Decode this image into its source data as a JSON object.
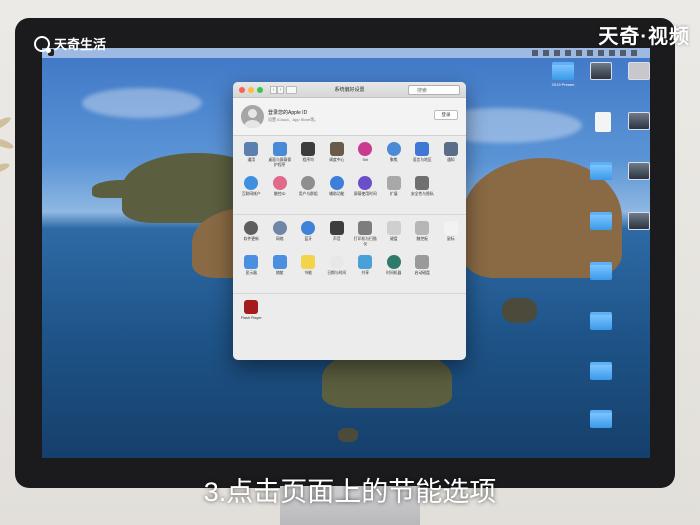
{
  "watermark": {
    "left": "天奇生活",
    "right": "天奇·视频"
  },
  "caption": "3.点击页面上的节能选项",
  "colors": {
    "accent": "#3a9ae8",
    "close": "#fc605b",
    "minimize": "#fdbc40",
    "zoom": "#34c84a"
  },
  "window": {
    "title": "系统偏好设置",
    "search_placeholder": "搜索",
    "account_title": "登录您的Apple ID",
    "account_subtitle": "设置 iCloud、App Store等。",
    "login_button": "登录"
  },
  "desktop_icons": [
    {
      "label": "2019 Presen"
    },
    {
      "label": ""
    },
    {
      "label": ""
    },
    {
      "label": ""
    },
    {
      "label": ""
    },
    {
      "label": ""
    },
    {
      "label": ""
    },
    {
      "label": ""
    },
    {
      "label": ""
    },
    {
      "label": ""
    },
    {
      "label": ""
    },
    {
      "label": ""
    },
    {
      "label": ""
    },
    {
      "label": ""
    },
    {
      "label": ""
    },
    {
      "label": ""
    }
  ],
  "panes_row1": [
    {
      "label": "通用",
      "icon": "general-icon",
      "color": "#5b7fae"
    },
    {
      "label": "桌面与屏幕保护程序",
      "icon": "desktop-icon",
      "color": "#4a88d8"
    },
    {
      "label": "程序坞",
      "icon": "dock-icon",
      "color": "#3c3c3c"
    },
    {
      "label": "调度中心",
      "icon": "mission-control-icon",
      "color": "#6a5a4a"
    },
    {
      "label": "Siri",
      "icon": "siri-icon",
      "color": "#c93b8e"
    },
    {
      "label": "聚焦",
      "icon": "spotlight-icon",
      "color": "#4b8ad6"
    },
    {
      "label": "语言与地区",
      "icon": "language-icon",
      "color": "#3f78d4"
    },
    {
      "label": "通知",
      "icon": "notifications-icon",
      "color": "#5a6c86"
    }
  ],
  "panes_row2": [
    {
      "label": "互联网帐户",
      "icon": "internet-accounts-icon",
      "color": "#3f8fe0"
    },
    {
      "label": "触控ID",
      "icon": "touch-id-icon",
      "color": "#e06a8a"
    },
    {
      "label": "用户与群组",
      "icon": "users-icon",
      "color": "#8e8e8e"
    },
    {
      "label": "辅助功能",
      "icon": "accessibility-icon",
      "color": "#3d7fd8"
    },
    {
      "label": "屏幕使用时间",
      "icon": "screen-time-icon",
      "color": "#6b4fc8"
    },
    {
      "label": "扩展",
      "icon": "extensions-icon",
      "color": "#a8a8a8"
    },
    {
      "label": "安全性与隐私",
      "icon": "security-icon",
      "color": "#6f6f6f"
    }
  ],
  "panes_row3": [
    {
      "label": "软件更新",
      "icon": "software-update-icon",
      "color": "#5e5e5e"
    },
    {
      "label": "网络",
      "icon": "network-icon",
      "color": "#6f86a8"
    },
    {
      "label": "蓝牙",
      "icon": "bluetooth-icon",
      "color": "#3f82d8"
    },
    {
      "label": "声音",
      "icon": "sound-icon",
      "color": "#3d3d3d"
    },
    {
      "label": "打印机与扫描仪",
      "icon": "printer-icon",
      "color": "#7d7d7d"
    },
    {
      "label": "键盘",
      "icon": "keyboard-icon",
      "color": "#cfcfcf"
    },
    {
      "label": "触控板",
      "icon": "trackpad-icon",
      "color": "#b6b6b6"
    },
    {
      "label": "鼠标",
      "icon": "mouse-icon",
      "color": "#f2f2f2"
    }
  ],
  "panes_row4": [
    {
      "label": "显示器",
      "icon": "displays-icon",
      "color": "#4a8fe0"
    },
    {
      "label": "随航",
      "icon": "sidecar-icon",
      "color": "#4a8fe0"
    },
    {
      "label": "节能",
      "icon": "energy-saver-icon",
      "color": "#f3d34a"
    },
    {
      "label": "日期与时间",
      "icon": "date-time-icon",
      "color": "#e8e8e8"
    },
    {
      "label": "共享",
      "icon": "sharing-icon",
      "color": "#4aa0d8"
    },
    {
      "label": "时间机器",
      "icon": "time-machine-icon",
      "color": "#2f7a6a"
    },
    {
      "label": "启动磁盘",
      "icon": "startup-disk-icon",
      "color": "#9a9a9a"
    }
  ],
  "panes_row5": [
    {
      "label": "Flash Player",
      "icon": "flash-player-icon",
      "color": "#a51b1b"
    }
  ]
}
